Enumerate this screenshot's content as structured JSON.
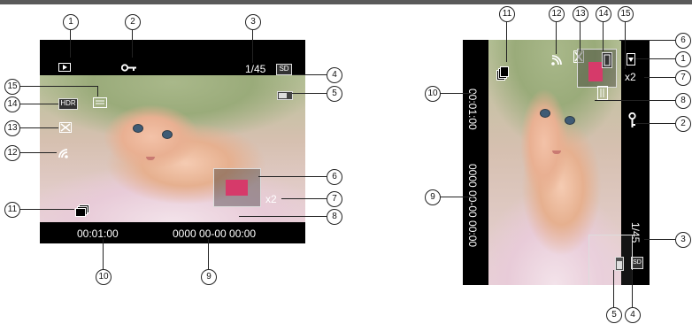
{
  "landscape": {
    "timecode": "00:01:00",
    "datetime": "0000  00-00  00:00",
    "counter": "1/45",
    "zoom": "x2",
    "sd": "SD",
    "hdr": "HDR"
  },
  "portrait": {
    "timecode": "00:01:00",
    "datetime": "0000  00-00  00:00",
    "counter": "1/45",
    "zoom": "x2",
    "sd": "SD"
  },
  "callouts": {
    "l1": "1",
    "l2": "2",
    "l3": "3",
    "l4": "4",
    "l5": "5",
    "l6": "6",
    "l7": "7",
    "l8": "8",
    "l9": "9",
    "l10": "10",
    "l11": "11",
    "l12": "12",
    "l13": "13",
    "l14": "14",
    "l15": "15",
    "r1": "1",
    "r2": "2",
    "r3": "3",
    "r4": "4",
    "r5": "5",
    "r6": "6",
    "r7": "7",
    "r8": "8",
    "r9": "9",
    "r10": "10",
    "r11": "11",
    "r12": "12",
    "r13": "13",
    "r14": "14",
    "r15": "15"
  },
  "icons": {
    "playback": "film-play-icon",
    "protect": "key-icon",
    "battery": "battery-icon",
    "continuous": "burst-icon",
    "wifi": "wifi-icon",
    "flash": "flash-off-icon",
    "quality": "quality-icon",
    "image_size": "image-size-icon"
  }
}
